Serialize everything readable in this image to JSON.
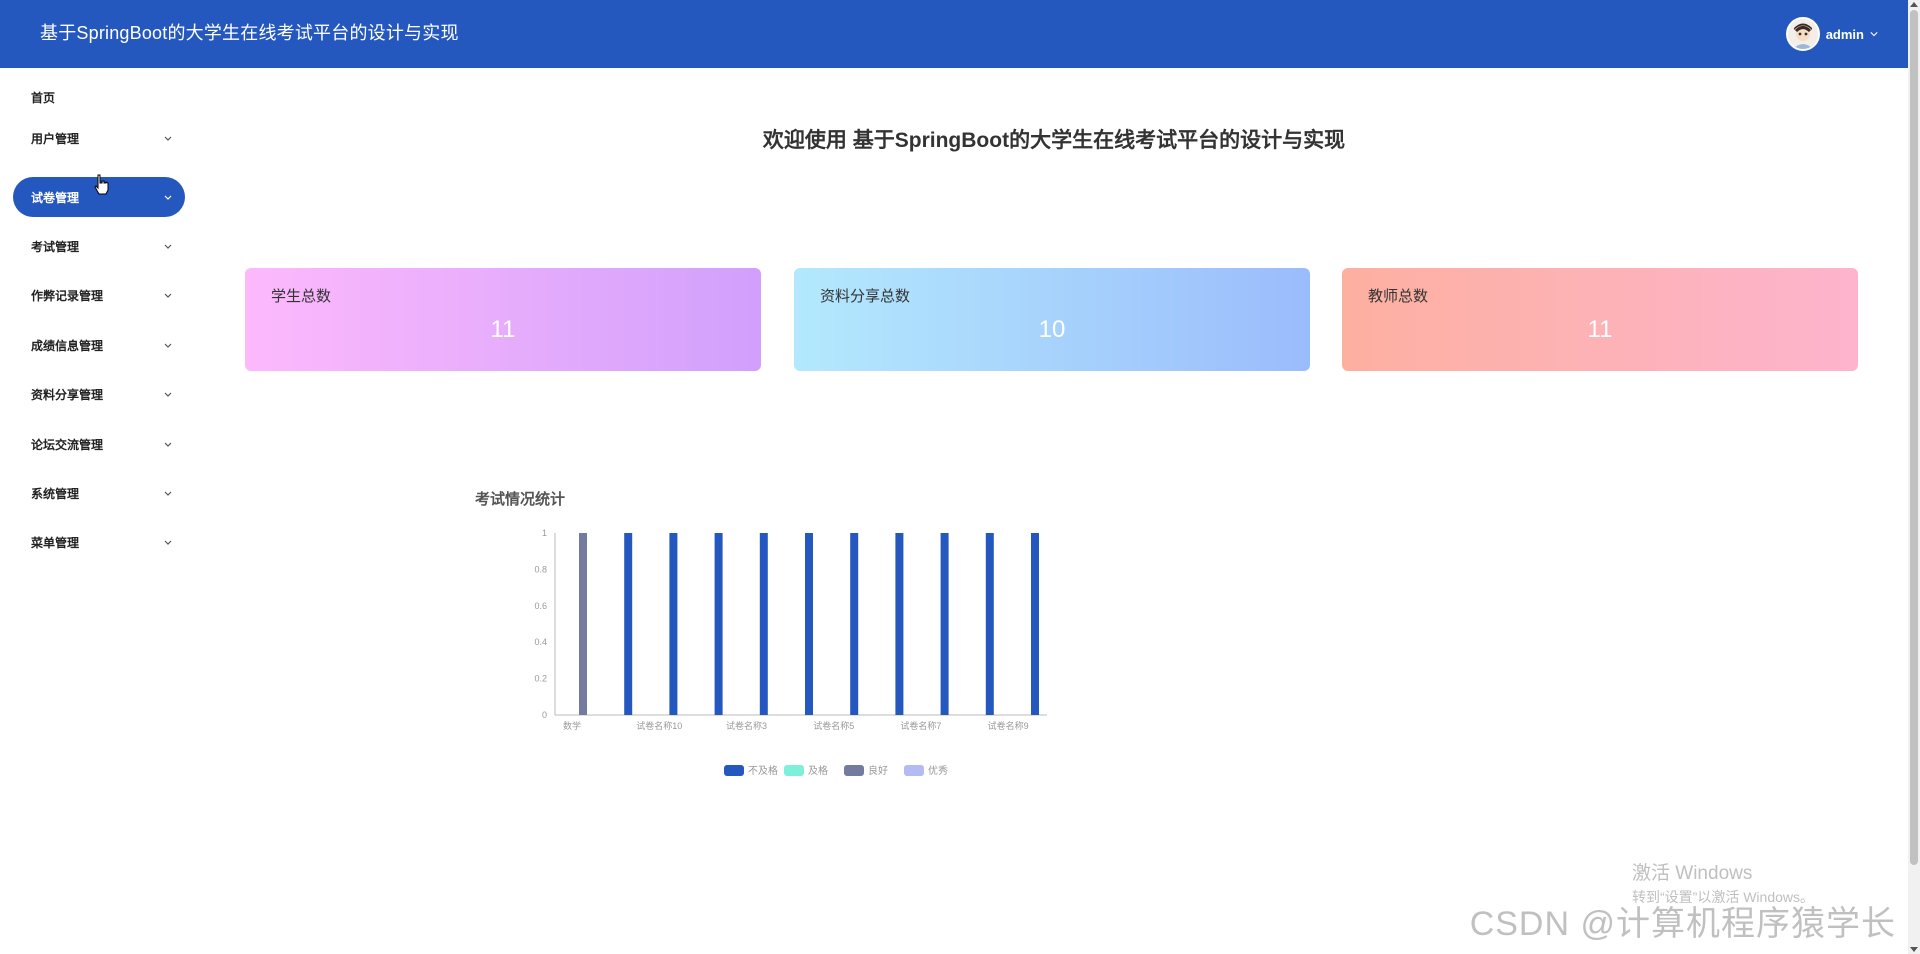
{
  "header": {
    "title": "基于SpringBoot的大学生在线考试平台的设计与实现",
    "username": "admin"
  },
  "sidebar": {
    "items": [
      {
        "label": "首页",
        "has_children": false,
        "active": false
      },
      {
        "label": "用户管理",
        "has_children": true,
        "active": false
      },
      {
        "label": "试卷管理",
        "has_children": true,
        "active": true
      },
      {
        "label": "考试管理",
        "has_children": true,
        "active": false
      },
      {
        "label": "作弊记录管理",
        "has_children": true,
        "active": false
      },
      {
        "label": "成绩信息管理",
        "has_children": true,
        "active": false
      },
      {
        "label": "资料分享管理",
        "has_children": true,
        "active": false
      },
      {
        "label": "论坛交流管理",
        "has_children": true,
        "active": false
      },
      {
        "label": "系统管理",
        "has_children": true,
        "active": false
      },
      {
        "label": "菜单管理",
        "has_children": true,
        "active": false
      }
    ]
  },
  "main": {
    "welcome": "欢迎使用 基于SpringBoot的大学生在线考试平台的设计与实现",
    "cards": [
      {
        "label": "学生总数",
        "value": "11"
      },
      {
        "label": "资料分享总数",
        "value": "10"
      },
      {
        "label": "教师总数",
        "value": "11"
      }
    ]
  },
  "chart_data": {
    "type": "bar",
    "title": "考试情况统计",
    "x_tick_labels": [
      "数学",
      "试卷名称10",
      "试卷名称3",
      "试卷名称5",
      "试卷名称7",
      "试卷名称9"
    ],
    "ylim": [
      0,
      1
    ],
    "y_ticks": [
      0,
      0.2,
      0.4,
      0.6,
      0.8,
      1
    ],
    "legend_position": "bottom",
    "series": [
      {
        "name": "不及格",
        "color": "#2558be"
      },
      {
        "name": "及格",
        "color": "#7ff0d8"
      },
      {
        "name": "良好",
        "color": "#737ba0"
      },
      {
        "name": "优秀",
        "color": "#b3baf4"
      }
    ],
    "bars": [
      {
        "series_index": 2,
        "value": 1
      },
      {
        "series_index": 0,
        "value": 1
      },
      {
        "series_index": 0,
        "value": 1
      },
      {
        "series_index": 0,
        "value": 1
      },
      {
        "series_index": 0,
        "value": 1
      },
      {
        "series_index": 0,
        "value": 1
      },
      {
        "series_index": 0,
        "value": 1
      },
      {
        "series_index": 0,
        "value": 1
      },
      {
        "series_index": 0,
        "value": 1
      },
      {
        "series_index": 0,
        "value": 1
      },
      {
        "series_index": 0,
        "value": 1
      }
    ]
  },
  "watermarks": {
    "windows_title": "激活 Windows",
    "windows_sub": "转到“设置”以激活 Windows。",
    "csdn": "CSDN @计算机程序猿学长"
  }
}
